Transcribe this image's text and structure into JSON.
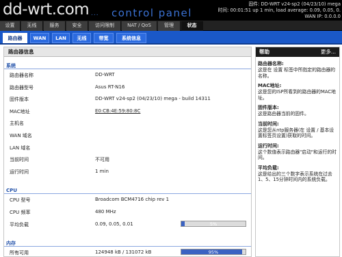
{
  "header": {
    "logo": "dd-wrt.com",
    "logo_dots": "...",
    "subtitle": "control panel",
    "firmware_line": "固件: DD-WRT v24-sp2 (04/23/10) mega",
    "time_line": "时间: 00:01:51 up 1 min, load average: 0.09, 0.05, 0.",
    "wan_line": "WAN IP: 0.0.0.0"
  },
  "mainnav": [
    "设置",
    "无线",
    "服务",
    "安全",
    "访问限制",
    "NAT / QoS",
    "管理",
    "状态"
  ],
  "subnav": [
    "路由器",
    "WAN",
    "LAN",
    "无线",
    "带宽",
    "系统信息"
  ],
  "panel": {
    "title": "路由器信息",
    "system": {
      "heading": "系统",
      "rows": [
        {
          "label": "路由器名称",
          "value": "DD-WRT"
        },
        {
          "label": "路由器型号",
          "value": "Asus RT-N16"
        },
        {
          "label": "固件版本",
          "value": "DD-WRT v24-sp2 (04/23/10) mega - build 14311"
        },
        {
          "label": "MAC地址",
          "value": "E0:CB:4E:59:80:8C"
        },
        {
          "label": "主机名",
          "value": ""
        },
        {
          "label": "WAN 域名",
          "value": ""
        },
        {
          "label": "LAN 域名",
          "value": ""
        },
        {
          "label": "当前时间",
          "value": "不可用"
        },
        {
          "label": "运行时间",
          "value": "1 min"
        }
      ]
    },
    "cpu": {
      "heading": "CPU",
      "rows": [
        {
          "label": "CPU 型号",
          "value": "Broadcom BCM4716 chip rev 1"
        },
        {
          "label": "CPU 频率",
          "value": "480 MHz"
        },
        {
          "label": "平均负载",
          "value": "0.09, 0.05, 0.01"
        }
      ],
      "load_percent": 5,
      "load_label": "5%"
    },
    "memory": {
      "heading": "内存",
      "rows": [
        {
          "label": "所有可用",
          "value": "124948 kB / 131072 kB"
        }
      ],
      "mem_percent": 95,
      "mem_label": "95%"
    }
  },
  "help": {
    "title": "帮助",
    "more": "更多...",
    "items": [
      {
        "heading": "路由器名称:",
        "text": "这是在 设置 标签中所指定的路由器的名称。"
      },
      {
        "heading": "MAC地址:",
        "text": "这是您的ISP所看到的路由器的MAC地址。"
      },
      {
        "heading": "固件版本:",
        "text": "这是路由器当前的固件。"
      },
      {
        "heading": "当前时间:",
        "text": "这是您从ntp服务器(在 设置 / 基本设置标签页设置)获取的时间。"
      },
      {
        "heading": "运行时间:",
        "text": "这个数值表示路由器\"启动\"和运行的时间。"
      },
      {
        "heading": "平均负载:",
        "text": "这是给出的三个数字表示系统在过去1、5、15分钟时间内的系统负载。"
      }
    ]
  },
  "colors": {
    "header_bg": "#000000",
    "accent_blue": "#1a58c8",
    "bar_fill": "#3a62c2"
  }
}
